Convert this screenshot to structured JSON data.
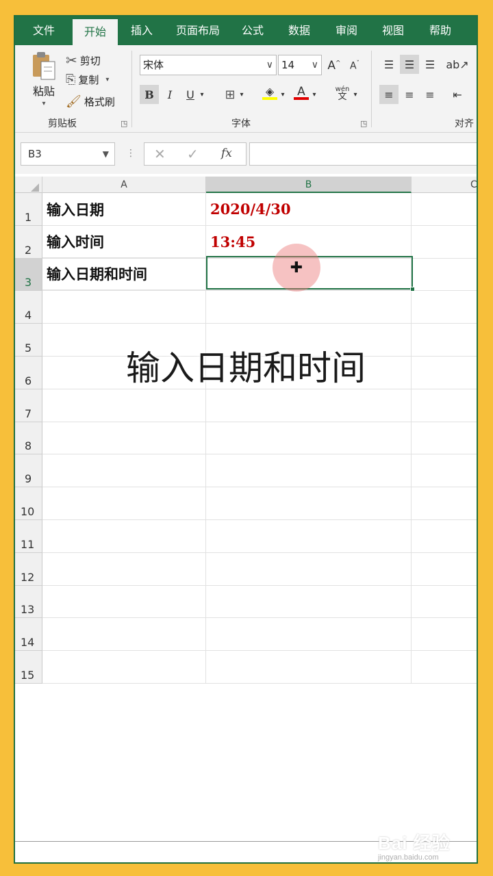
{
  "ribbon_tabs": [
    "文件",
    "开始",
    "插入",
    "页面布局",
    "公式",
    "数据",
    "审阅",
    "视图",
    "帮助"
  ],
  "active_tab_index": 1,
  "clipboard": {
    "paste_label": "粘贴",
    "cut_label": "剪切",
    "copy_label": "复制",
    "format_painter_label": "格式刷",
    "group_label": "剪贴板"
  },
  "font_group": {
    "font_name": "宋体",
    "font_size": "14",
    "group_label": "字体",
    "bold": "B",
    "italic": "I",
    "underline": "U",
    "font_color_accent": "#e00000",
    "fill_color_accent": "#ffff00",
    "phonetic_label_top": "wén",
    "phonetic_label_bottom": "文"
  },
  "align_group": {
    "group_label": "对齐"
  },
  "formula_bar": {
    "name_box": "B3",
    "formula": ""
  },
  "columns": [
    "A",
    "B",
    "C"
  ],
  "selected_column": "B",
  "rows": [
    "1",
    "2",
    "3",
    "4",
    "5",
    "6",
    "7",
    "8",
    "9",
    "10",
    "11",
    "12",
    "13",
    "14",
    "15"
  ],
  "selected_row": "3",
  "cells": {
    "A1": "输入日期",
    "B1": "2020/4/30",
    "A2": "输入时间",
    "B2": "13:45",
    "A3": "输入日期和时间",
    "B3": ""
  },
  "caption": "输入日期和时间",
  "watermark": {
    "logo_text": "Bai 经验",
    "url": "jingyan.baidu.com"
  },
  "colors": {
    "excel_green": "#217346",
    "value_red": "#c00000",
    "frame_yellow": "#f7bf3a"
  }
}
